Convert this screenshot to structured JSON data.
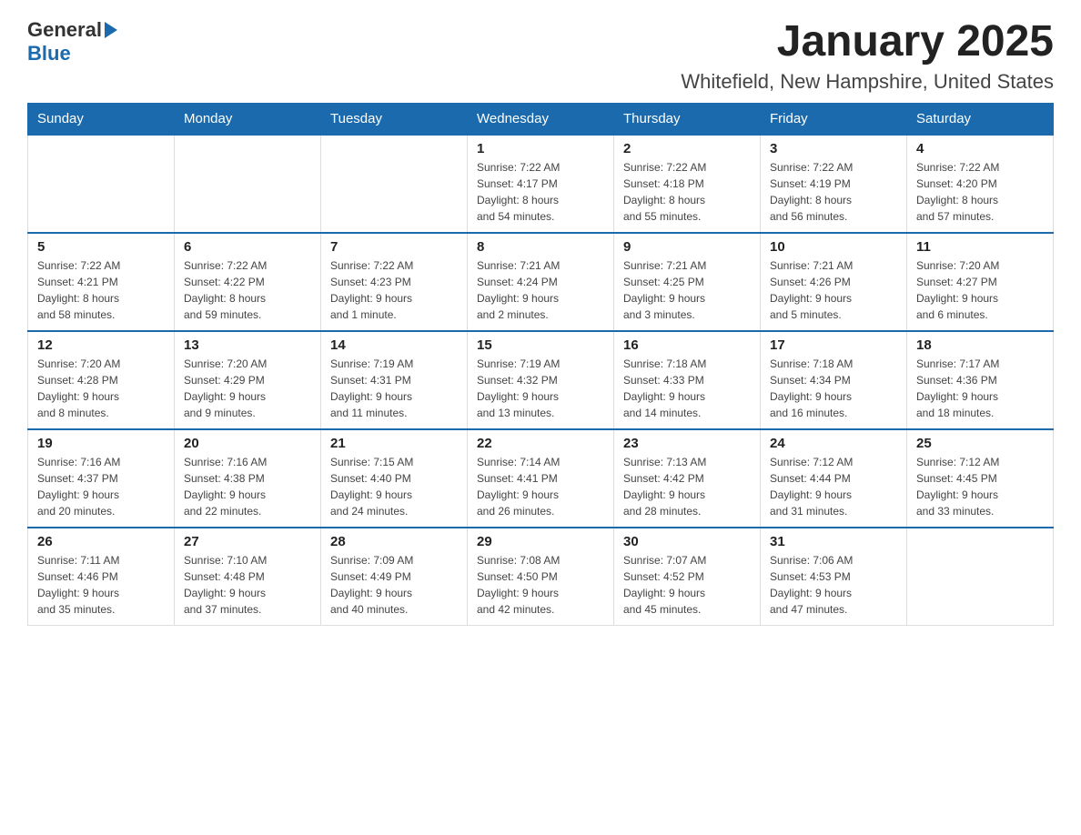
{
  "header": {
    "logo_general": "General",
    "logo_blue": "Blue",
    "month_title": "January 2025",
    "location": "Whitefield, New Hampshire, United States"
  },
  "weekdays": [
    "Sunday",
    "Monday",
    "Tuesday",
    "Wednesday",
    "Thursday",
    "Friday",
    "Saturday"
  ],
  "weeks": [
    [
      {
        "day": "",
        "info": ""
      },
      {
        "day": "",
        "info": ""
      },
      {
        "day": "",
        "info": ""
      },
      {
        "day": "1",
        "info": "Sunrise: 7:22 AM\nSunset: 4:17 PM\nDaylight: 8 hours\nand 54 minutes."
      },
      {
        "day": "2",
        "info": "Sunrise: 7:22 AM\nSunset: 4:18 PM\nDaylight: 8 hours\nand 55 minutes."
      },
      {
        "day": "3",
        "info": "Sunrise: 7:22 AM\nSunset: 4:19 PM\nDaylight: 8 hours\nand 56 minutes."
      },
      {
        "day": "4",
        "info": "Sunrise: 7:22 AM\nSunset: 4:20 PM\nDaylight: 8 hours\nand 57 minutes."
      }
    ],
    [
      {
        "day": "5",
        "info": "Sunrise: 7:22 AM\nSunset: 4:21 PM\nDaylight: 8 hours\nand 58 minutes."
      },
      {
        "day": "6",
        "info": "Sunrise: 7:22 AM\nSunset: 4:22 PM\nDaylight: 8 hours\nand 59 minutes."
      },
      {
        "day": "7",
        "info": "Sunrise: 7:22 AM\nSunset: 4:23 PM\nDaylight: 9 hours\nand 1 minute."
      },
      {
        "day": "8",
        "info": "Sunrise: 7:21 AM\nSunset: 4:24 PM\nDaylight: 9 hours\nand 2 minutes."
      },
      {
        "day": "9",
        "info": "Sunrise: 7:21 AM\nSunset: 4:25 PM\nDaylight: 9 hours\nand 3 minutes."
      },
      {
        "day": "10",
        "info": "Sunrise: 7:21 AM\nSunset: 4:26 PM\nDaylight: 9 hours\nand 5 minutes."
      },
      {
        "day": "11",
        "info": "Sunrise: 7:20 AM\nSunset: 4:27 PM\nDaylight: 9 hours\nand 6 minutes."
      }
    ],
    [
      {
        "day": "12",
        "info": "Sunrise: 7:20 AM\nSunset: 4:28 PM\nDaylight: 9 hours\nand 8 minutes."
      },
      {
        "day": "13",
        "info": "Sunrise: 7:20 AM\nSunset: 4:29 PM\nDaylight: 9 hours\nand 9 minutes."
      },
      {
        "day": "14",
        "info": "Sunrise: 7:19 AM\nSunset: 4:31 PM\nDaylight: 9 hours\nand 11 minutes."
      },
      {
        "day": "15",
        "info": "Sunrise: 7:19 AM\nSunset: 4:32 PM\nDaylight: 9 hours\nand 13 minutes."
      },
      {
        "day": "16",
        "info": "Sunrise: 7:18 AM\nSunset: 4:33 PM\nDaylight: 9 hours\nand 14 minutes."
      },
      {
        "day": "17",
        "info": "Sunrise: 7:18 AM\nSunset: 4:34 PM\nDaylight: 9 hours\nand 16 minutes."
      },
      {
        "day": "18",
        "info": "Sunrise: 7:17 AM\nSunset: 4:36 PM\nDaylight: 9 hours\nand 18 minutes."
      }
    ],
    [
      {
        "day": "19",
        "info": "Sunrise: 7:16 AM\nSunset: 4:37 PM\nDaylight: 9 hours\nand 20 minutes."
      },
      {
        "day": "20",
        "info": "Sunrise: 7:16 AM\nSunset: 4:38 PM\nDaylight: 9 hours\nand 22 minutes."
      },
      {
        "day": "21",
        "info": "Sunrise: 7:15 AM\nSunset: 4:40 PM\nDaylight: 9 hours\nand 24 minutes."
      },
      {
        "day": "22",
        "info": "Sunrise: 7:14 AM\nSunset: 4:41 PM\nDaylight: 9 hours\nand 26 minutes."
      },
      {
        "day": "23",
        "info": "Sunrise: 7:13 AM\nSunset: 4:42 PM\nDaylight: 9 hours\nand 28 minutes."
      },
      {
        "day": "24",
        "info": "Sunrise: 7:12 AM\nSunset: 4:44 PM\nDaylight: 9 hours\nand 31 minutes."
      },
      {
        "day": "25",
        "info": "Sunrise: 7:12 AM\nSunset: 4:45 PM\nDaylight: 9 hours\nand 33 minutes."
      }
    ],
    [
      {
        "day": "26",
        "info": "Sunrise: 7:11 AM\nSunset: 4:46 PM\nDaylight: 9 hours\nand 35 minutes."
      },
      {
        "day": "27",
        "info": "Sunrise: 7:10 AM\nSunset: 4:48 PM\nDaylight: 9 hours\nand 37 minutes."
      },
      {
        "day": "28",
        "info": "Sunrise: 7:09 AM\nSunset: 4:49 PM\nDaylight: 9 hours\nand 40 minutes."
      },
      {
        "day": "29",
        "info": "Sunrise: 7:08 AM\nSunset: 4:50 PM\nDaylight: 9 hours\nand 42 minutes."
      },
      {
        "day": "30",
        "info": "Sunrise: 7:07 AM\nSunset: 4:52 PM\nDaylight: 9 hours\nand 45 minutes."
      },
      {
        "day": "31",
        "info": "Sunrise: 7:06 AM\nSunset: 4:53 PM\nDaylight: 9 hours\nand 47 minutes."
      },
      {
        "day": "",
        "info": ""
      }
    ]
  ]
}
